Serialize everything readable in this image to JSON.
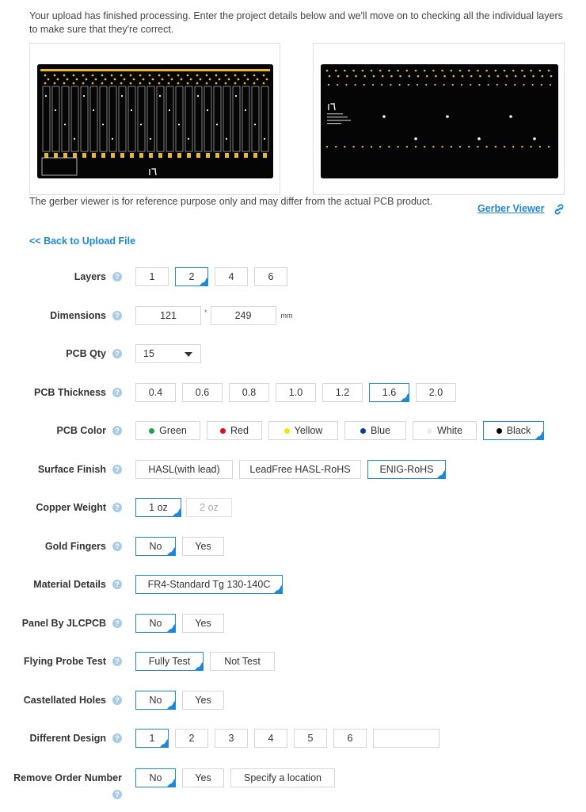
{
  "intro_text": "Your upload has finished processing. Enter the project details below and we'll move on to checking all the individual layers to make sure that they're correct.",
  "previews": {
    "left_alt": "Top layer gerber preview",
    "right_alt": "Bottom layer gerber preview"
  },
  "disclaimer": "The gerber viewer is for reference purpose only and may differ from the actual PCB product.",
  "gerber_viewer_label": "Gerber Viewer",
  "back_link": "<< Back to Upload File",
  "help_glyph": "?",
  "accent_color": "#1e88d8",
  "form": {
    "layers": {
      "label": "Layers",
      "options": [
        "1",
        "2",
        "4",
        "6"
      ],
      "selected": "2"
    },
    "dimensions": {
      "label": "Dimensions",
      "width": "121",
      "separator": "*",
      "height": "249",
      "unit": "mm"
    },
    "pcb_qty": {
      "label": "PCB Qty",
      "value": "15"
    },
    "pcb_thickness": {
      "label": "PCB Thickness",
      "options": [
        "0.4",
        "0.6",
        "0.8",
        "1.0",
        "1.2",
        "1.6",
        "2.0"
      ],
      "selected": "1.6"
    },
    "pcb_color": {
      "label": "PCB Color",
      "options": [
        {
          "name": "Green",
          "color": "#2aa149"
        },
        {
          "name": "Red",
          "color": "#d8101c"
        },
        {
          "name": "Yellow",
          "color": "#f4e20a"
        },
        {
          "name": "Blue",
          "color": "#0b3f8f"
        },
        {
          "name": "White",
          "color": "#eeeeee"
        },
        {
          "name": "Black",
          "color": "#000000"
        }
      ],
      "selected": "Black"
    },
    "surface_finish": {
      "label": "Surface Finish",
      "options": [
        "HASL(with lead)",
        "LeadFree HASL-RoHS",
        "ENIG-RoHS"
      ],
      "selected": "ENIG-RoHS"
    },
    "copper_weight": {
      "label": "Copper Weight",
      "options": [
        "1 oz",
        "2 oz"
      ],
      "selected": "1 oz",
      "disabled": [
        "2 oz"
      ]
    },
    "gold_fingers": {
      "label": "Gold Fingers",
      "options": [
        "No",
        "Yes"
      ],
      "selected": "No"
    },
    "material_details": {
      "label": "Material Details",
      "options": [
        "FR4-Standard Tg 130-140C"
      ],
      "selected": "FR4-Standard Tg 130-140C"
    },
    "panel_by_jlcpcb": {
      "label": "Panel By JLCPCB",
      "options": [
        "No",
        "Yes"
      ],
      "selected": "No"
    },
    "flying_probe_test": {
      "label": "Flying Probe Test",
      "options": [
        "Fully Test",
        "Not Test"
      ],
      "selected": "Fully Test"
    },
    "castellated_holes": {
      "label": "Castellated Holes",
      "options": [
        "No",
        "Yes"
      ],
      "selected": "No"
    },
    "different_design": {
      "label": "Different Design",
      "options": [
        "1",
        "2",
        "3",
        "4",
        "5",
        "6"
      ],
      "selected": "1",
      "custom_value": ""
    },
    "remove_order_number": {
      "label": "Remove Order Number",
      "options": [
        "No",
        "Yes",
        "Specify a location"
      ],
      "selected": "No"
    }
  }
}
